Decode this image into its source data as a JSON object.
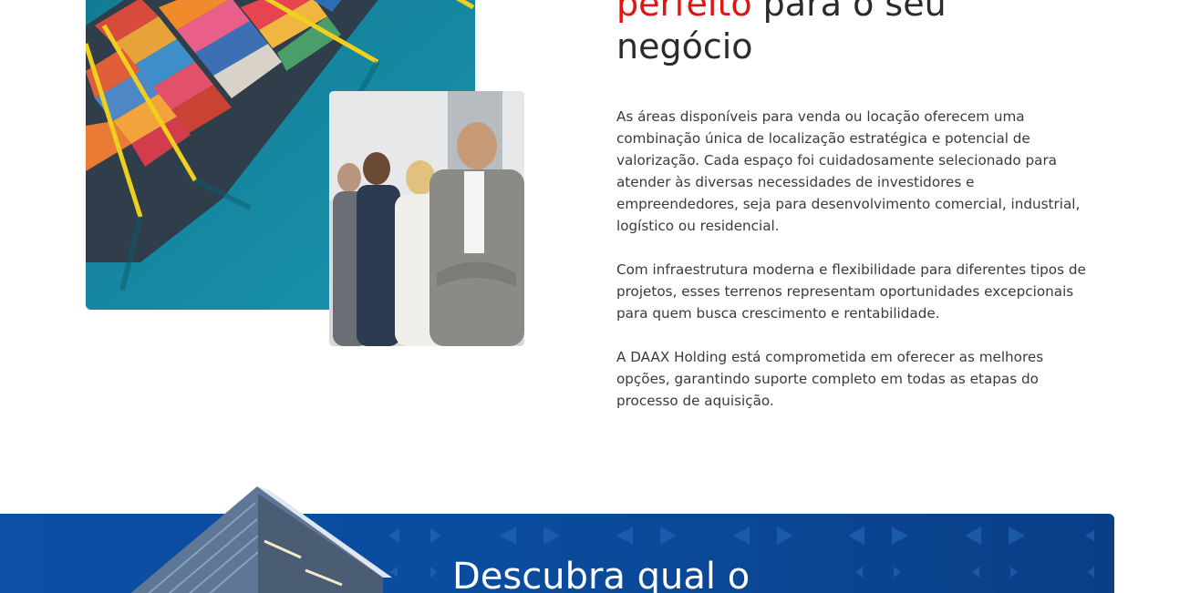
{
  "about": {
    "heading_accent": "perfeito",
    "heading_rest": " para o seu",
    "heading_line2": "negócio",
    "paragraphs": [
      "As áreas disponíveis para venda ou locação oferecem uma combinação única de localização estratégica e potencial de valorização. Cada espaço foi cuidadosamente selecionado para atender às diversas necessidades de investidores e empreendedores, seja para desenvolvimento comercial, industrial, logístico ou residencial.",
      "Com infraestrutura moderna e flexibilidade para diferentes tipos de projetos, esses terrenos representam oportunidades excepcionais para quem busca crescimento e rentabilidade.",
      "A DAAX Holding está comprometida em oferecer as melhores opções, garantindo suporte completo em todas as etapas do processo de aquisição."
    ],
    "images": {
      "ship": "container-ship-aerial-image",
      "team": "business-team-photo"
    }
  },
  "banner": {
    "title": "Descubra qual o",
    "image": "warehouse-building-image",
    "pattern_icon": "arrow-triangle-pattern"
  },
  "colors": {
    "accent": "#e11414",
    "text": "#2b2b2b",
    "banner_blue": "#0b4fa6"
  }
}
